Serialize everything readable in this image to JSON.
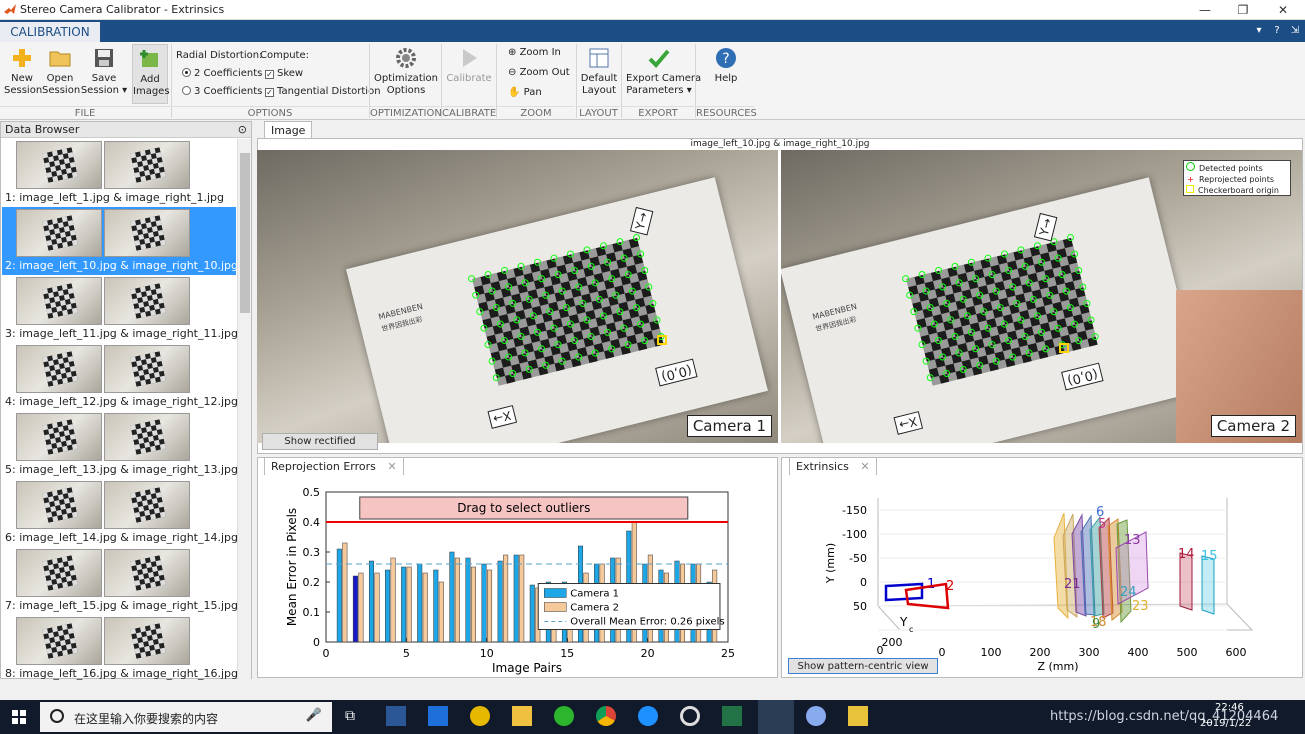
{
  "window": {
    "title": "Stereo Camera Calibrator - Extrinsics",
    "minimize": "—",
    "restore": "❐",
    "close": "✕"
  },
  "ribbon_tab": "CALIBRATION",
  "toolstrip": {
    "new_session": "New\nSession",
    "open_session": "Open\nSession",
    "save_session": "Save\nSession ▾",
    "add_images": "Add\nImages",
    "file_group": "FILE",
    "radial_label": "Radial Distortion:",
    "radial_2": "2 Coefficients",
    "radial_3": "3 Coefficients",
    "compute_label": "Compute:",
    "skew": "Skew",
    "tangential": "Tangential Distortion",
    "options_group": "OPTIONS",
    "optimization": "Optimization\nOptions",
    "optimization_group": "OPTIMIZATION",
    "calibrate": "Calibrate",
    "calibrate_group": "CALIBRATE",
    "zoom_in": "Zoom In",
    "zoom_out": "Zoom Out",
    "pan": "Pan",
    "zoom_group": "ZOOM",
    "default_layout": "Default\nLayout",
    "layout_group": "LAYOUT",
    "export": "Export Camera\nParameters ▾",
    "export_group": "EXPORT",
    "help": "Help",
    "resources_group": "RESOURCES"
  },
  "data_browser": {
    "title": "Data Browser",
    "items": [
      "1: image_left_1.jpg & image_right_1.jpg",
      "2: image_left_10.jpg & image_right_10.jpg",
      "3: image_left_11.jpg & image_right_11.jpg",
      "4: image_left_12.jpg & image_right_12.jpg",
      "5: image_left_13.jpg & image_right_13.jpg",
      "6: image_left_14.jpg & image_right_14.jpg",
      "7: image_left_15.jpg & image_right_15.jpg",
      "8: image_left_16.jpg & image_right_16.jpg"
    ],
    "selected_index": 1
  },
  "image_pane": {
    "tab": "Image",
    "caption": "image_left_10.jpg & image_right_10.jpg",
    "camera1": "Camera 1",
    "camera2": "Camera 2",
    "show_rectified": "Show rectified",
    "legend": [
      "Detected points",
      "Reprojected points",
      "Checkerboard origin"
    ],
    "board_brand": "MABENBEN",
    "board_sub": "世界因我出彩",
    "marks": {
      "origin": "(0,0)",
      "x": "X→",
      "y": "Y→"
    }
  },
  "reprojection": {
    "tab": "Reprojection Errors",
    "close": "✕"
  },
  "extrinsics": {
    "tab": "Extrinsics",
    "close": "✕",
    "show_pattern_centric": "Show pattern-centric view",
    "ylabel": "Y (mm)",
    "zlabel": "Z (mm)",
    "yticks": [
      "-150",
      "-100",
      "-50",
      "0",
      "50"
    ],
    "zticks": [
      "0",
      "100",
      "200",
      "300",
      "400",
      "500",
      "600"
    ],
    "xticks": [
      "200",
      "0"
    ],
    "axis_letter": "Y",
    "axis_sub": "c",
    "camera_labels": [
      "1",
      "2"
    ],
    "board_labels": [
      "6",
      "5",
      "13",
      "21",
      "24",
      "23",
      "14",
      "15",
      "18",
      "9"
    ],
    "colors": {
      "cam1": "#0000cc",
      "cam2": "#dd0000"
    }
  },
  "chart_data": {
    "type": "bar",
    "title": "Drag to select outliers",
    "xlabel": "Image Pairs",
    "ylabel": "Mean Error in Pixels",
    "xlim": [
      0,
      25
    ],
    "ylim": [
      0,
      0.5
    ],
    "xticks": [
      "0",
      "5",
      "10",
      "15",
      "20",
      "25"
    ],
    "yticks": [
      "0",
      "0.1",
      "0.2",
      "0.3",
      "0.4",
      "0.5"
    ],
    "outlier_threshold": 0.4,
    "overall_mean": 0.26,
    "selected_pair": 2,
    "categories": [
      1,
      2,
      3,
      4,
      5,
      6,
      7,
      8,
      9,
      10,
      11,
      12,
      13,
      14,
      15,
      16,
      17,
      18,
      19,
      20,
      21,
      22,
      23,
      24
    ],
    "series": [
      {
        "name": "Camera 1",
        "color": "#1ea7e6",
        "values": [
          0.31,
          0.22,
          0.27,
          0.24,
          0.25,
          0.26,
          0.24,
          0.3,
          0.28,
          0.26,
          0.27,
          0.29,
          0.19,
          0.2,
          0.2,
          0.32,
          0.26,
          0.28,
          0.37,
          0.26,
          0.24,
          0.27,
          0.26,
          0.2
        ]
      },
      {
        "name": "Camera 2",
        "color": "#f5c99a",
        "values": [
          0.33,
          0.23,
          0.23,
          0.28,
          0.25,
          0.23,
          0.2,
          0.28,
          0.25,
          0.24,
          0.29,
          0.29,
          0.18,
          0.19,
          0.19,
          0.23,
          0.26,
          0.28,
          0.4,
          0.29,
          0.23,
          0.26,
          0.26,
          0.24
        ]
      }
    ],
    "legend": [
      "Camera 1",
      "Camera 2",
      "Overall Mean Error: 0.26 pixels"
    ]
  },
  "taskbar": {
    "search_placeholder": "在这里输入你要搜索的内容",
    "time": "22:46",
    "date": "2019/1/22",
    "watermark": "https://blog.csdn.net/qq_41204464"
  }
}
